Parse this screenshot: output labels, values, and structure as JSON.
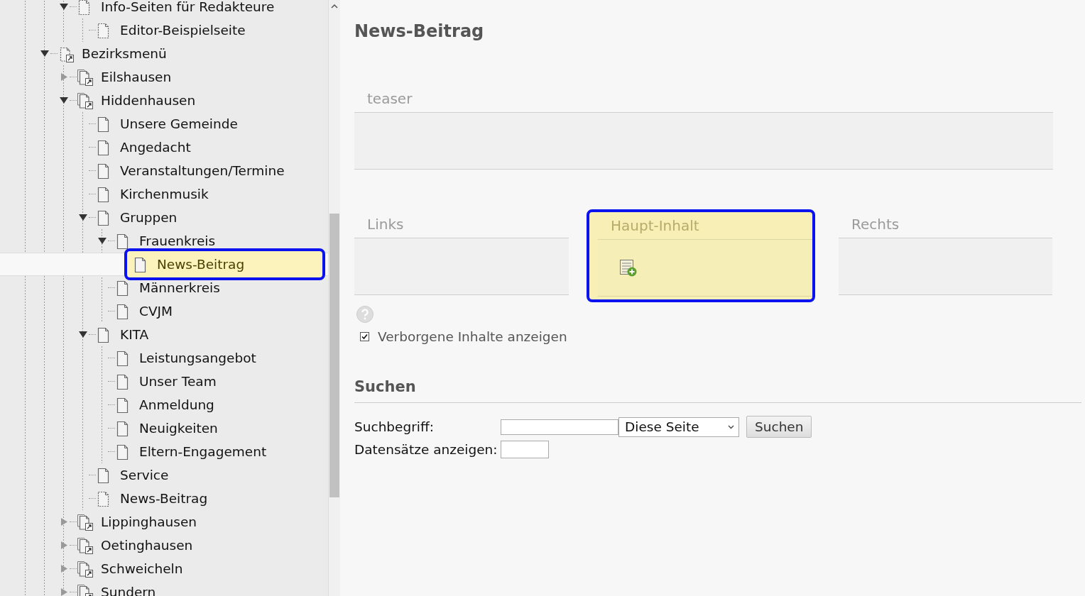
{
  "tree": [
    {
      "children": [
        {
          "children": [
            {
              "children": [
                {
                  "label": "Info-Seiten für Redakteure",
                  "kind": "hidden",
                  "expanded": true,
                  "selected": false,
                  "children": [
                    {
                      "label": "Editor-Beispielseite",
                      "kind": "hidden",
                      "selected": false
                    }
                  ]
                }
              ]
            },
            {
              "label": "Bezirksmenü",
              "kind": "hidden-shortcut",
              "expanded": true,
              "selected": false,
              "children": [
                {
                  "label": "Eilshausen",
                  "kind": "shortcut",
                  "expanded": false,
                  "selected": false
                },
                {
                  "label": "Hiddenhausen",
                  "kind": "shortcut",
                  "expanded": true,
                  "selected": false,
                  "children": [
                    {
                      "label": "Unsere Gemeinde",
                      "kind": "page",
                      "selected": false
                    },
                    {
                      "label": "Angedacht",
                      "kind": "page",
                      "selected": false
                    },
                    {
                      "label": "Veranstaltungen/Termine",
                      "kind": "page",
                      "selected": false
                    },
                    {
                      "label": "Kirchenmusik",
                      "kind": "page",
                      "selected": false
                    },
                    {
                      "label": "Gruppen",
                      "kind": "page",
                      "expanded": true,
                      "selected": false,
                      "children": [
                        {
                          "label": "Frauenkreis",
                          "kind": "page",
                          "expanded": true,
                          "selected": false,
                          "children": [
                            {
                              "label": "News-Beitrag",
                              "kind": "page",
                              "selected": true
                            }
                          ]
                        },
                        {
                          "label": "Männerkreis",
                          "kind": "page",
                          "selected": false
                        },
                        {
                          "label": "CVJM",
                          "kind": "page",
                          "selected": false
                        }
                      ]
                    },
                    {
                      "label": "KITA",
                      "kind": "page",
                      "expanded": true,
                      "selected": false,
                      "children": [
                        {
                          "label": "Leistungsangebot",
                          "kind": "page",
                          "selected": false
                        },
                        {
                          "label": "Unser Team",
                          "kind": "page",
                          "selected": false
                        },
                        {
                          "label": "Anmeldung",
                          "kind": "page",
                          "selected": false
                        },
                        {
                          "label": "Neuigkeiten",
                          "kind": "page",
                          "selected": false
                        },
                        {
                          "label": "Eltern-Engagement",
                          "kind": "page",
                          "selected": false
                        }
                      ]
                    },
                    {
                      "label": "Service",
                      "kind": "page",
                      "selected": false
                    },
                    {
                      "label": "News-Beitrag",
                      "kind": "hidden",
                      "selected": false
                    }
                  ]
                },
                {
                  "label": "Lippinghausen",
                  "kind": "shortcut",
                  "expanded": false,
                  "selected": false
                },
                {
                  "label": "Oetinghausen",
                  "kind": "shortcut",
                  "expanded": false,
                  "selected": false
                },
                {
                  "label": "Schweicheln",
                  "kind": "shortcut",
                  "expanded": false,
                  "selected": false
                },
                {
                  "label": "Sundern",
                  "kind": "shortcut",
                  "expanded": false,
                  "selected": false
                }
              ]
            }
          ]
        }
      ]
    }
  ],
  "page_title": "News-Beitrag",
  "teaser": {
    "title": "teaser"
  },
  "columns": [
    {
      "title": "Links",
      "selected": false
    },
    {
      "title": "Haupt-Inhalt",
      "selected": true
    },
    {
      "title": "Rechts",
      "selected": false
    }
  ],
  "hidden_content": {
    "label": "Verborgene Inhalte anzeigen",
    "checked": true
  },
  "search": {
    "heading": "Suchen",
    "term_label": "Suchbegriff:",
    "scope": "Diese Seite",
    "button": "Suchen",
    "count_label": "Datensätze anzeigen:"
  }
}
